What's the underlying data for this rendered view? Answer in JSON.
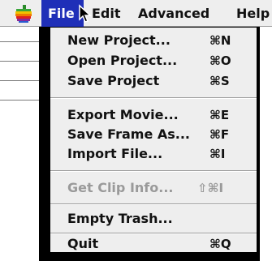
{
  "menubar": {
    "titles": [
      "File",
      "Edit",
      "Advanced",
      "Help"
    ],
    "active_title": "File"
  },
  "file_menu": {
    "items": [
      {
        "label": "New Project...",
        "shortcut": "⌘N",
        "enabled": true
      },
      {
        "label": "Open Project...",
        "shortcut": "⌘O",
        "enabled": true
      },
      {
        "label": "Save Project",
        "shortcut": "⌘S",
        "enabled": true
      },
      {
        "label": "Export Movie...",
        "shortcut": "⌘E",
        "enabled": true
      },
      {
        "label": "Save Frame As...",
        "shortcut": "⌘F",
        "enabled": true
      },
      {
        "label": "Import File...",
        "shortcut": "⌘I",
        "enabled": true
      },
      {
        "label": "Get Clip Info...",
        "shortcut": "⇧⌘I",
        "enabled": false
      },
      {
        "label": "Empty Trash...",
        "shortcut": "",
        "enabled": true
      },
      {
        "label": "Quit",
        "shortcut": "⌘Q",
        "enabled": true
      }
    ]
  },
  "colors": {
    "menu_highlight": "#1f2fb8",
    "menu_background": "#eeeeee",
    "disabled_text": "#9a9a9a"
  },
  "icons": [
    "apple-logo-icon",
    "arrow-cursor-icon"
  ]
}
